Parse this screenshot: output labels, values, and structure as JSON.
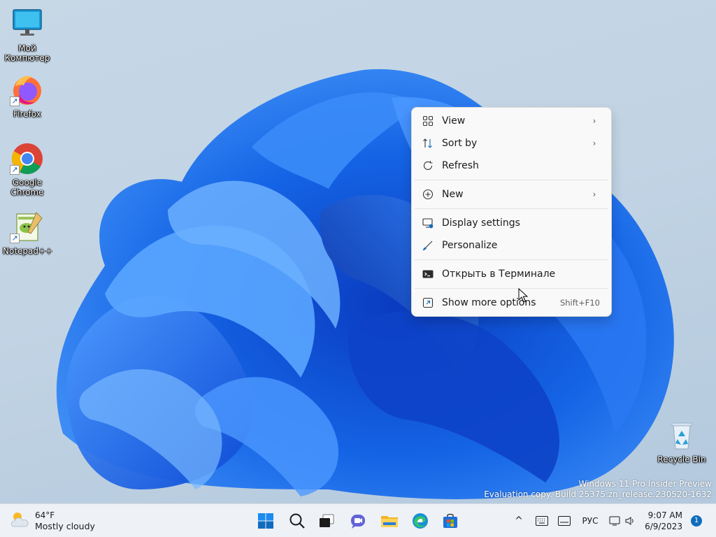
{
  "desktop": {
    "icons": [
      {
        "label": "Мой\nКомпютер",
        "icon": "monitor-icon"
      },
      {
        "label": "Firefox",
        "icon": "firefox-icon"
      },
      {
        "label": "Google\nChrome",
        "icon": "chrome-icon"
      },
      {
        "label": "Notepad++",
        "icon": "notepad-plus-plus-icon"
      }
    ],
    "recycle_bin": {
      "label": "Recycle Bin",
      "icon": "recycle-bin-icon"
    },
    "watermark": {
      "line1": "Windows 11 Pro Insider Preview",
      "line2": "Evaluation copy. Build 25375.zn_release.230520-1632"
    }
  },
  "context_menu": {
    "groups": [
      [
        {
          "label": "View",
          "icon": "view-grid-icon",
          "submenu": true
        },
        {
          "label": "Sort by",
          "icon": "sort-icon",
          "submenu": true
        },
        {
          "label": "Refresh",
          "icon": "refresh-icon",
          "submenu": false
        }
      ],
      [
        {
          "label": "New",
          "icon": "plus-circle-icon",
          "submenu": true
        }
      ],
      [
        {
          "label": "Display settings",
          "icon": "display-settings-icon",
          "submenu": false
        },
        {
          "label": "Personalize",
          "icon": "brush-icon",
          "submenu": false
        }
      ],
      [
        {
          "label": "Открыть в Терминале",
          "icon": "terminal-icon",
          "submenu": false
        }
      ],
      [
        {
          "label": "Show more options",
          "icon": "show-more-icon",
          "submenu": false,
          "shortcut": "Shift+F10"
        }
      ]
    ]
  },
  "taskbar": {
    "weather": {
      "temperature": "64°F",
      "condition": "Mostly cloudy",
      "icon": "cloud-sun-icon"
    },
    "apps": [
      "start-icon",
      "search-icon",
      "task-view-icon",
      "teams-chat-icon",
      "file-explorer-icon",
      "edge-icon",
      "store-icon"
    ],
    "tray": {
      "chevron": "^",
      "language": "РУС",
      "time": "9:07 AM",
      "date": "6/9/2023",
      "notifications": "1"
    }
  },
  "colors": {
    "accent": "#0f6cbd",
    "wallpaper_bloom": "#1a6fe8",
    "menu_bg": "#f9f9f9"
  }
}
